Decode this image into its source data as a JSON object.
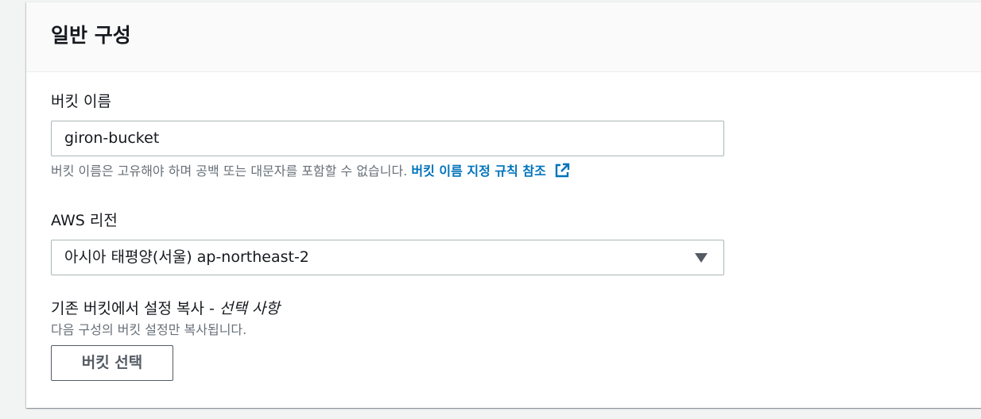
{
  "section": {
    "title": "일반 구성"
  },
  "bucket_name": {
    "label": "버킷 이름",
    "value": "giron-bucket",
    "hint_text": "버킷 이름은 고유해야 하며 공백 또는 대문자를 포함할 수 없습니다. ",
    "hint_link": "버킷 이름 지정 규칙 참조",
    "hint_link_icon": "external-link-icon"
  },
  "region": {
    "label": "AWS 리전",
    "selected": "아시아 태평양(서울) ap-northeast-2",
    "arrow_icon": "caret-down-icon"
  },
  "copy_settings": {
    "label_main": "기존 버킷에서 설정 복사 - ",
    "label_optional": "선택 사항",
    "description": "다음 구성의 버킷 설정만 복사됩니다.",
    "button_label": "버킷 선택"
  },
  "colors": {
    "link": "#0073bb",
    "text": "#16191f",
    "hint": "#687078",
    "border": "#aab7b8"
  }
}
